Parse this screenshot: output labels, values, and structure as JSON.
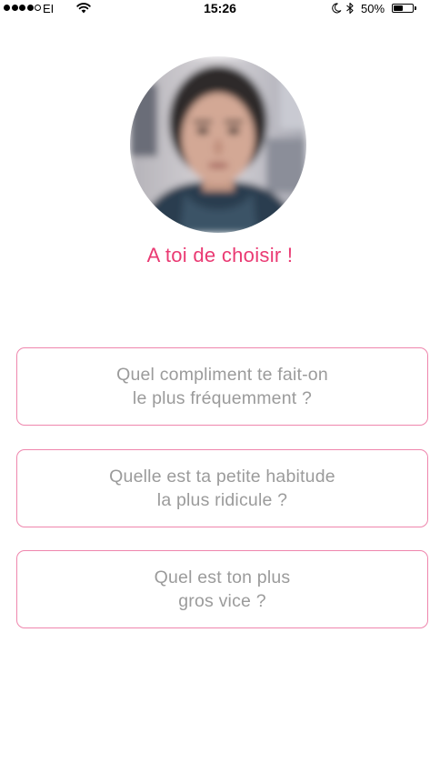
{
  "status_bar": {
    "carrier": "EI",
    "time": "15:26",
    "battery_percent": "50%",
    "battery_level": 0.5,
    "signal_bars_filled": 4,
    "signal_bars_total": 5,
    "icons": [
      "signal-dots-icon",
      "wifi-icon",
      "moon-icon",
      "bluetooth-icon",
      "battery-icon"
    ]
  },
  "avatar": {
    "description_icon": "profile-photo"
  },
  "heading": "A toi de choisir !",
  "choices": [
    {
      "line1": "Quel compliment te fait-on",
      "line2": "le plus fréquemment ?"
    },
    {
      "line1": "Quelle est ta petite habitude",
      "line2": "la plus ridicule ?"
    },
    {
      "line1": "Quel est ton plus",
      "line2": "gros vice ?"
    }
  ],
  "colors": {
    "accent": "#ea3a73",
    "card_border": "#ef86ad",
    "card_text": "#9b9b9b",
    "background": "#ffffff"
  }
}
